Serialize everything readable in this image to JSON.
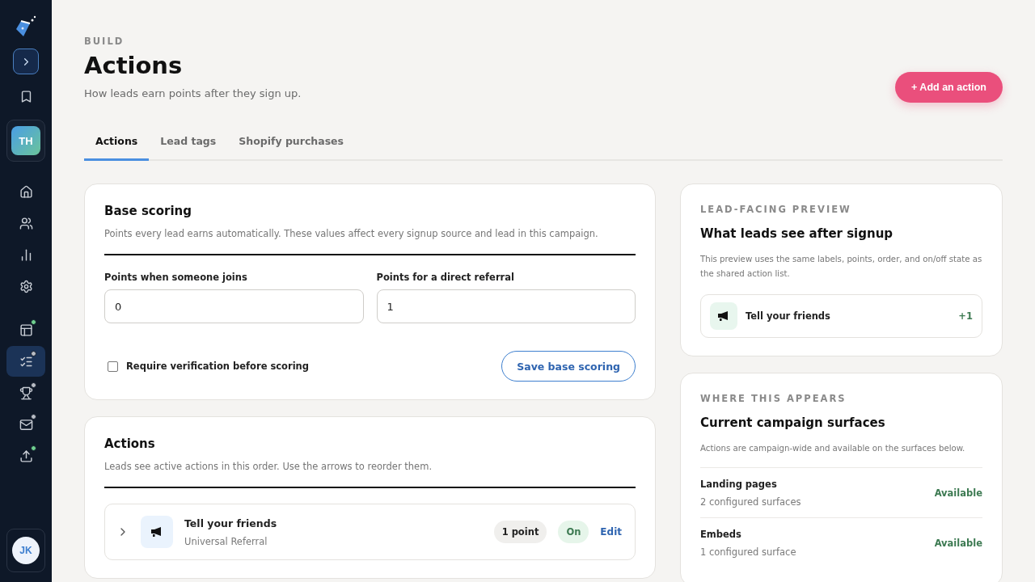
{
  "sidebar": {
    "workspace": "TH",
    "user": "JK",
    "top_items": [
      {
        "selected": false
      },
      {
        "selected": false
      },
      {
        "selected": false
      },
      {
        "selected": false
      }
    ],
    "build_items": [
      {
        "selected": false,
        "color": "#6fcf8f"
      },
      {
        "selected": true,
        "color": "#b8bcc4"
      },
      {
        "selected": false,
        "color": "#b8bcc4"
      },
      {
        "selected": false,
        "color": "#b8bcc4"
      },
      {
        "selected": false,
        "color": "#6fcf8f"
      }
    ]
  },
  "header": {
    "eyebrow": "BUILD",
    "title": "Actions",
    "subtitle": "How leads earn points after they sign up.",
    "primary_button": "+ Add an action"
  },
  "tabs": [
    {
      "label": "Actions",
      "selected": true
    },
    {
      "label": "Lead tags",
      "selected": false
    },
    {
      "label": "Shopify purchases",
      "selected": false
    }
  ],
  "base_scoring": {
    "title": "Base scoring",
    "description": "Points every lead earns automatically. These values affect every signup source and lead in this campaign.",
    "fields": [
      {
        "label": "Points when someone joins",
        "value": "0"
      },
      {
        "label": "Points for a direct referral",
        "value": "1"
      }
    ],
    "checkbox": {
      "label": "Require verification before scoring",
      "checked": false
    },
    "save_button": "Save base scoring"
  },
  "actions": {
    "title": "Actions",
    "description": "Leads see active actions in this order. Use the arrows to reorder them.",
    "rows": [
      {
        "name": "Tell your friends",
        "type": "Universal Referral",
        "points": "1 point",
        "status": "On",
        "on": true,
        "edit": "Edit",
        "expanded": false
      }
    ]
  },
  "preview": {
    "eyebrow": "LEAD-FACING PREVIEW",
    "title": "What leads see after signup",
    "description": "This preview uses the same labels, points, order, and on/off state as the shared action list.",
    "items": [
      {
        "name": "Tell your friends",
        "points": "+1"
      }
    ]
  },
  "surfaces": {
    "eyebrow": "WHERE THIS APPEARS",
    "title": "Current campaign surfaces",
    "description": "Actions are campaign-wide and available on the surfaces below.",
    "rows": [
      {
        "name": "Landing pages",
        "detail": "2 configured surfaces",
        "status": "Available"
      },
      {
        "name": "Embeds",
        "detail": "1 configured surface",
        "status": "Available"
      }
    ]
  }
}
